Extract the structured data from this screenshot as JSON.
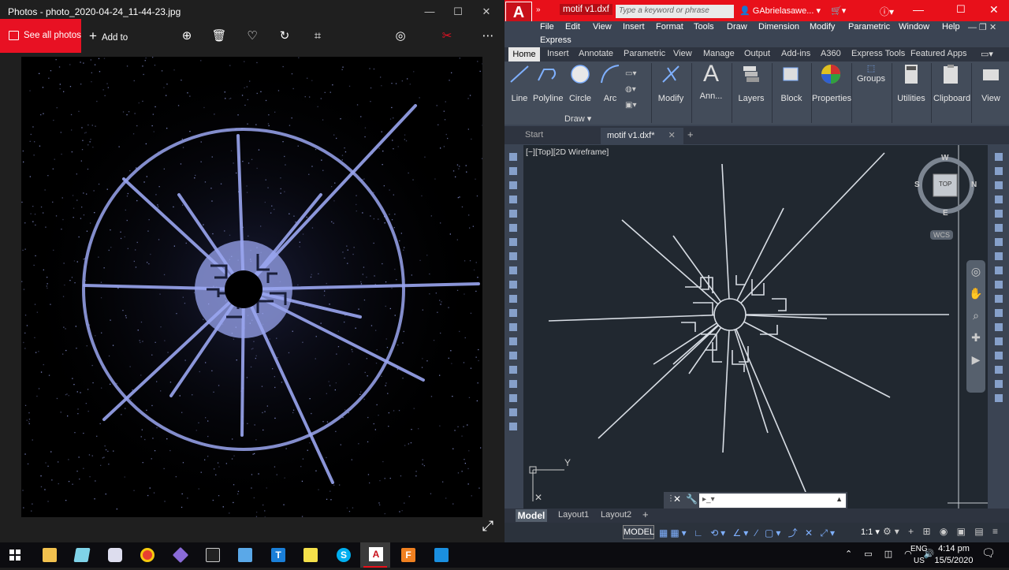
{
  "photos": {
    "title": "Photos - photo_2020-04-24_11-44-23.jpg",
    "see_all": "See all photos",
    "add_to": "Add to"
  },
  "acad": {
    "file_tab": "motif v1.dxf",
    "search_placeholder": "Type a keyword or phrase",
    "user": "GAbrielasawe...",
    "menus": [
      "File",
      "Edit",
      "View",
      "Insert",
      "Format",
      "Tools",
      "Draw",
      "Dimension",
      "Modify",
      "Parametric",
      "Window",
      "Help"
    ],
    "menu_express": "Express",
    "ribbon_tabs": [
      "Home",
      "Insert",
      "Annotate",
      "Parametric",
      "View",
      "Manage",
      "Output",
      "Add-ins",
      "A360",
      "Express Tools",
      "Featured Apps"
    ],
    "ribbon_buttons": [
      "Line",
      "Polyline",
      "Circle",
      "Arc",
      "Modify",
      "Ann...",
      "Layers",
      "Block",
      "Properties",
      "Groups",
      "Utilities",
      "Clipboard",
      "View"
    ],
    "draw_panel": "Draw",
    "doc_tabs": {
      "start": "Start",
      "motif": "motif v1.dxf*"
    },
    "viewport_label": "[−][Top][2D Wireframe]",
    "viewcube": {
      "top": "TOP",
      "n": "N",
      "s": "S",
      "e": "E",
      "w": "W"
    },
    "wcs": "WCS",
    "ucs_y": "Y",
    "layout_tabs": [
      "Model",
      "Layout1",
      "Layout2"
    ],
    "status_model": "MODEL",
    "status_scale": "1:1"
  },
  "taskbar": {
    "lang1": "ENG",
    "lang2": "US",
    "time": "4:14 pm",
    "date": "15/5/2020"
  },
  "colors": {
    "acad_red": "#e8101a",
    "photos_red": "#e81123",
    "motif_blue": "#9aa6f0"
  }
}
